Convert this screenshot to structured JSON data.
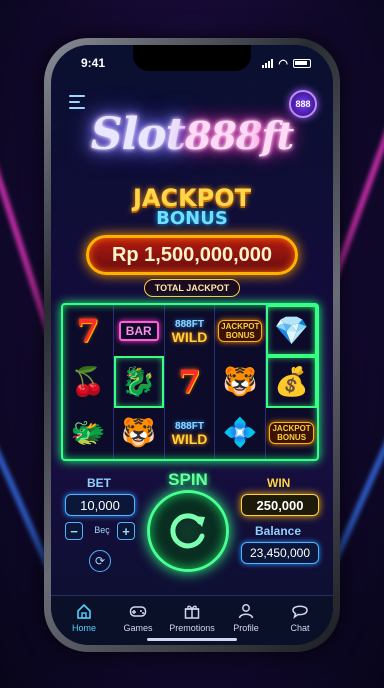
{
  "status": {
    "time": "9:41"
  },
  "header": {
    "logo_main": "Slot",
    "logo_number": "888",
    "logo_tail": "ft",
    "badge": "888"
  },
  "jackpot": {
    "title": "JACKPOT",
    "subtitle": "BONUS",
    "amount": "Rp 1,500,000,000",
    "label": "TOTAL JACKPOT"
  },
  "reels": [
    [
      {
        "type": "seven",
        "text": "7"
      },
      {
        "type": "bar",
        "text": "BAR"
      },
      {
        "type": "wild",
        "top": "888FT",
        "bottom": "WILD"
      },
      {
        "type": "jb",
        "top": "JACKPOT",
        "bottom": "BONUS"
      },
      {
        "type": "emoji",
        "icon": "emerald-icon",
        "glyph": "💎"
      }
    ],
    [
      {
        "type": "emoji",
        "icon": "cherries-icon",
        "glyph": "🍒"
      },
      {
        "type": "emoji",
        "icon": "dragon-icon",
        "glyph": "🐉"
      },
      {
        "type": "seven",
        "text": "7"
      },
      {
        "type": "emoji",
        "icon": "tiger-icon",
        "glyph": "🐯"
      },
      {
        "type": "emoji",
        "icon": "gold-ingot-icon",
        "glyph": "💰"
      }
    ],
    [
      {
        "type": "emoji",
        "icon": "dragon-icon",
        "glyph": "🐲"
      },
      {
        "type": "emoji",
        "icon": "tiger-icon",
        "glyph": "🐯"
      },
      {
        "type": "wild",
        "top": "888FT",
        "bottom": "WILD"
      },
      {
        "type": "emoji",
        "icon": "diamond-icon",
        "glyph": "💠"
      },
      {
        "type": "jb",
        "top": "JACKPOT",
        "bottom": "BONUS"
      }
    ]
  ],
  "controls": {
    "bet_label": "BET",
    "bet_value": "10,000",
    "bet_step_label": "Beç",
    "spin_label": "SPIN",
    "win_label": "WIN",
    "win_value": "250,000",
    "balance_label": "Balance",
    "balance_value": "23,450,000"
  },
  "tabs": [
    {
      "label": "Home",
      "icon": "home-icon",
      "active": true
    },
    {
      "label": "Games",
      "icon": "gamepad-icon",
      "active": false
    },
    {
      "label": "Premotions",
      "icon": "gift-icon",
      "active": false
    },
    {
      "label": "Profile",
      "icon": "user-icon",
      "active": false
    },
    {
      "label": "Chat",
      "icon": "chat-icon",
      "active": false
    }
  ],
  "colors": {
    "accent_green": "#39ff7e",
    "accent_blue": "#4ab6ff",
    "gold": "#ffd33a"
  }
}
